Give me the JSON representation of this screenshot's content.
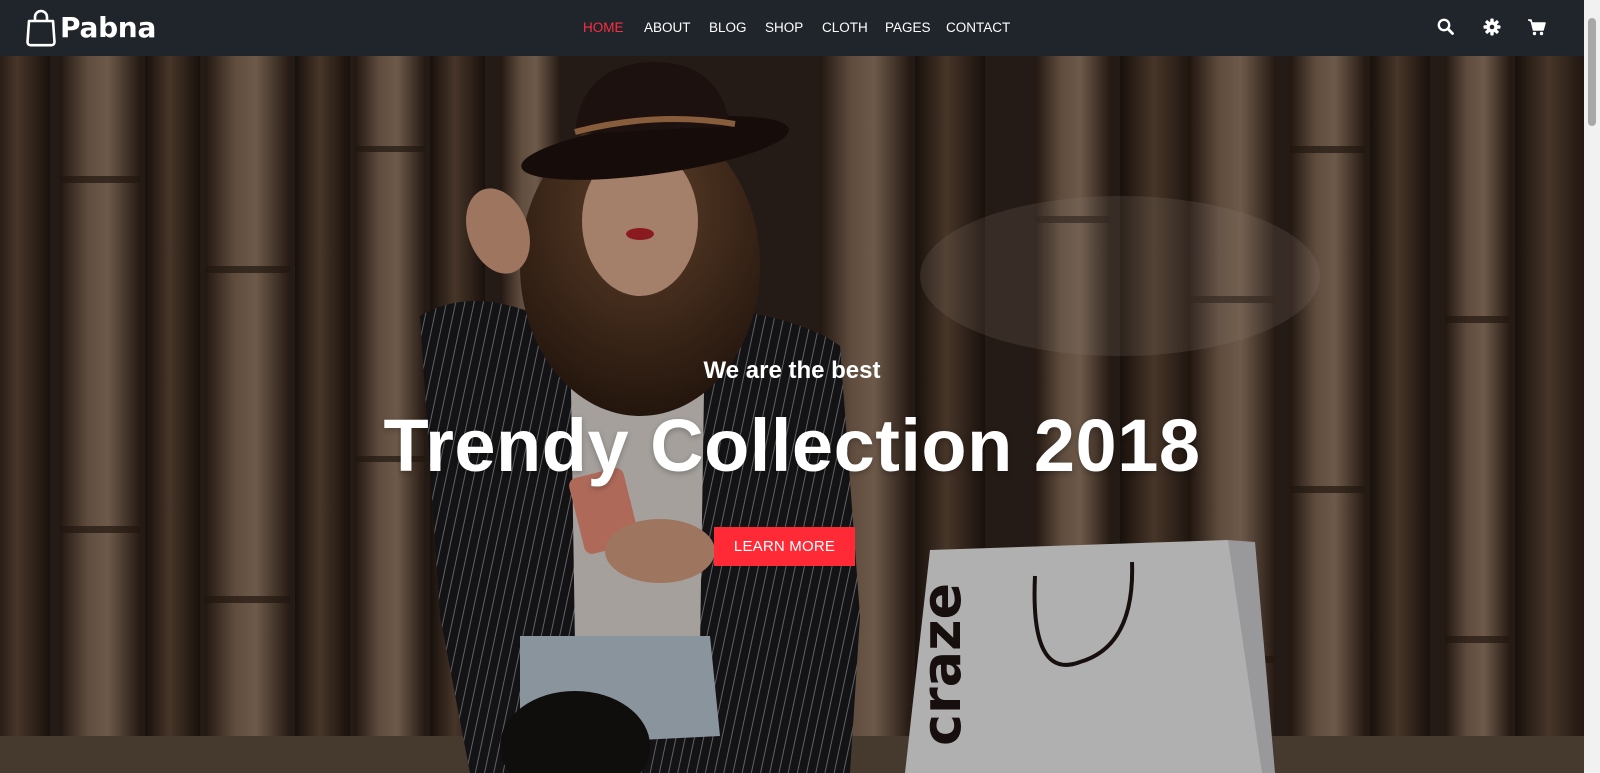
{
  "brand": {
    "name": "Pabna",
    "icon": "shopping-bag-icon"
  },
  "nav": {
    "items": [
      {
        "label": "HOME",
        "active": true
      },
      {
        "label": "ABOUT",
        "active": false
      },
      {
        "label": "BLOG",
        "active": false
      },
      {
        "label": "SHOP",
        "active": false
      },
      {
        "label": "CLOTH",
        "active": false
      },
      {
        "label": "PAGES",
        "active": false
      },
      {
        "label": "CONTACT",
        "active": false
      }
    ],
    "icons": [
      "search-icon",
      "gear-icon",
      "cart-icon"
    ]
  },
  "hero": {
    "subtitle": "We are the best",
    "title": "Trendy Collection 2018",
    "button_label": "LEARN MORE",
    "bag_text": "craze"
  },
  "colors": {
    "navbar_bg": "#1f252a",
    "accent": "#ff2a36",
    "active_link": "#ff2d42",
    "text": "#ffffff"
  }
}
